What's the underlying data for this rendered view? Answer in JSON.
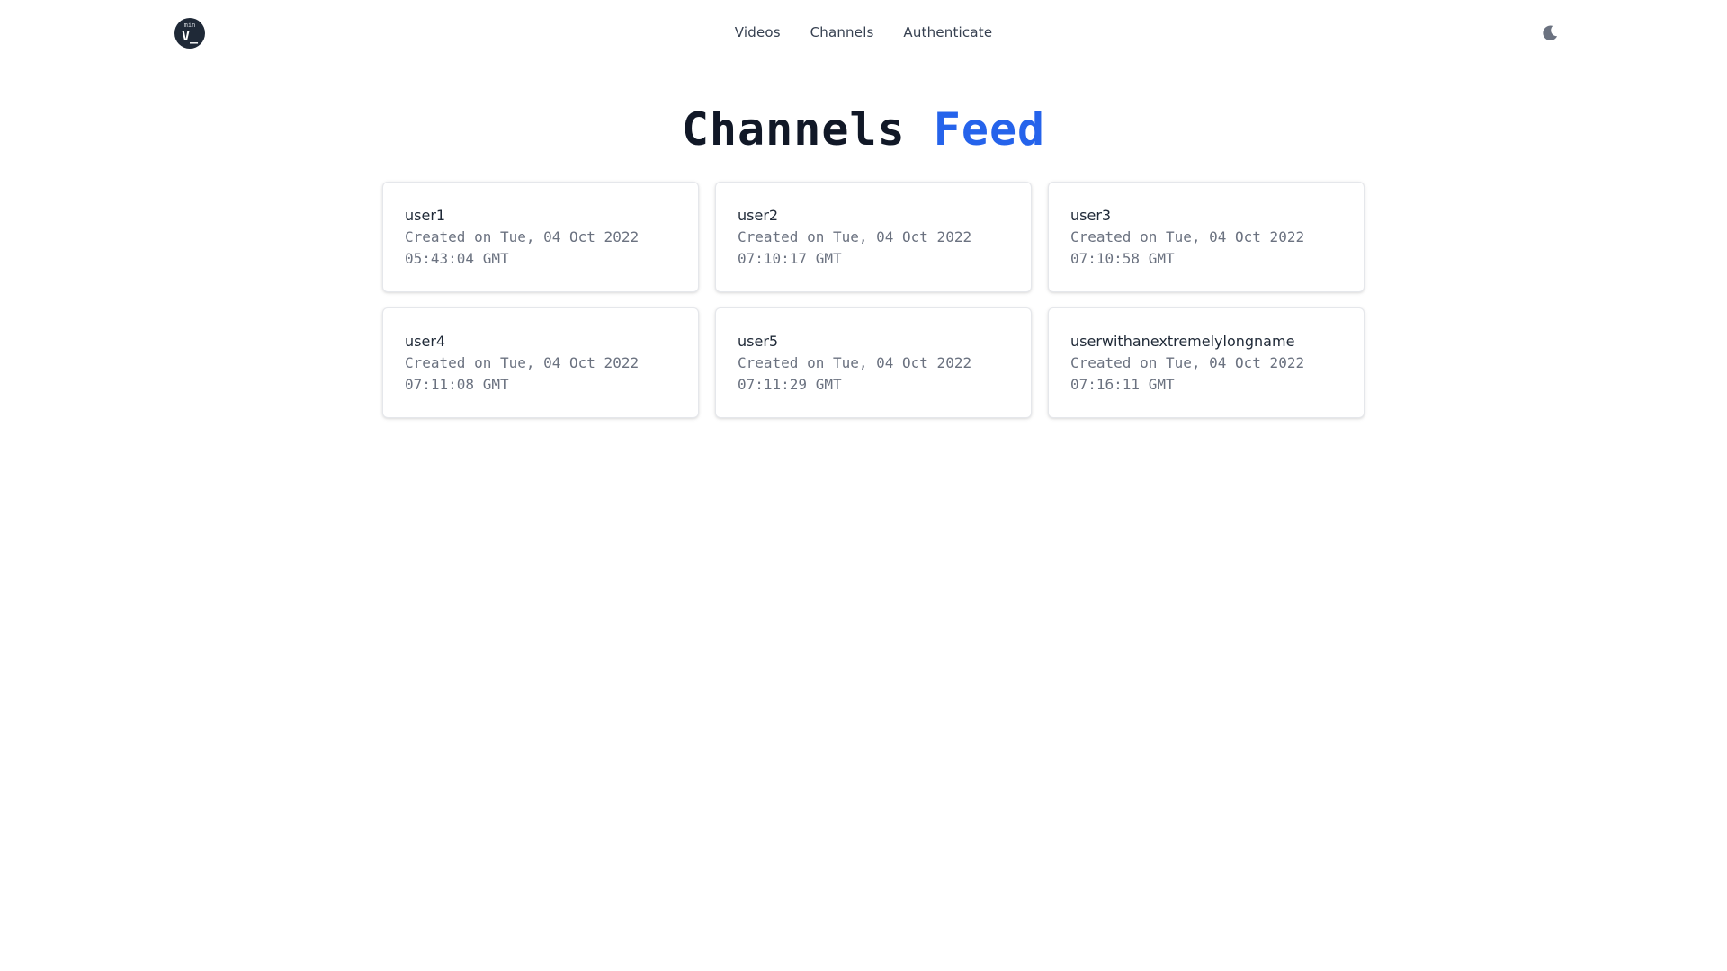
{
  "nav": {
    "logo": {
      "small_text": "min",
      "main_text": "V_"
    },
    "links": [
      {
        "label": "Videos"
      },
      {
        "label": "Channels"
      },
      {
        "label": "Authenticate"
      }
    ],
    "theme_toggle_icon": "moon-icon"
  },
  "page": {
    "title_main": "Channels",
    "title_accent": "Feed",
    "accent_color": "#2563eb"
  },
  "channels": [
    {
      "name": "user1",
      "created": "Created on Tue, 04 Oct 2022 05:43:04 GMT"
    },
    {
      "name": "user2",
      "created": "Created on Tue, 04 Oct 2022 07:10:17 GMT"
    },
    {
      "name": "user3",
      "created": "Created on Tue, 04 Oct 2022 07:10:58 GMT"
    },
    {
      "name": "user4",
      "created": "Created on Tue, 04 Oct 2022 07:11:08 GMT"
    },
    {
      "name": "user5",
      "created": "Created on Tue, 04 Oct 2022 07:11:29 GMT"
    },
    {
      "name": "userwithanextremelylongname",
      "created": "Created on Tue, 04 Oct 2022 07:16:11 GMT"
    }
  ]
}
